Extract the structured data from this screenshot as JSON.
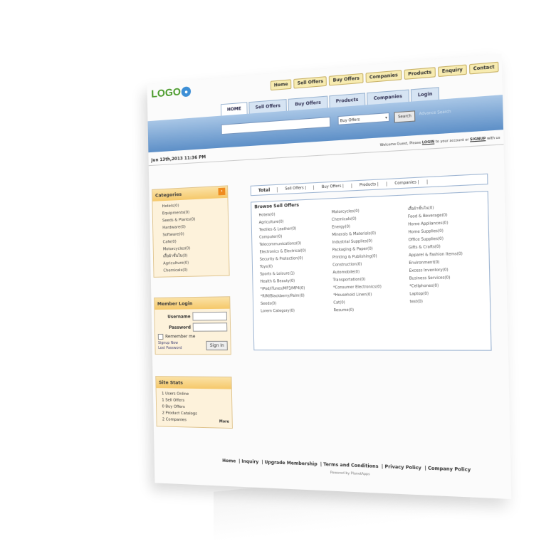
{
  "logo": "LOGO",
  "topnav": [
    "Home",
    "Sell Offers",
    "Buy Offers",
    "Companies",
    "Products",
    "Enquiry",
    "Contact"
  ],
  "tabs": [
    "HOME",
    "Sell Offers",
    "Buy Offers",
    "Products",
    "Companies",
    "Login"
  ],
  "search": {
    "select_value": "Buy Offers",
    "button": "Search",
    "advanced": "Advance Search"
  },
  "date": "Jun 13th,2013 11:36 PM",
  "welcome": {
    "prefix": "Welcome Guest, Please",
    "login": "LOGIN",
    "middle": "to your account or",
    "signup": "SIGNUP",
    "suffix": "with us"
  },
  "categories": {
    "title": "Categories",
    "items": [
      "Hotels(0)",
      "Equipments(0)",
      "Seeds & Plants(0)",
      "Hardware(0)",
      "Software(0)",
      "Cafe(0)",
      "Motorcycles(0)",
      "เสื้อผ้าชั้นใน(0)",
      "Agriculture(0)",
      "Chemicals(0)"
    ]
  },
  "login": {
    "title": "Member Login",
    "username": "Username",
    "password": "Password",
    "remember": "Remember me",
    "signup": "Signup Now",
    "lost": "Lost Password",
    "button": "Sign In"
  },
  "stats": {
    "title": "Site Stats",
    "items": [
      "1 Users Online",
      "1 Sell Offers",
      "0 Buy Offers",
      "2 Product Catalogs",
      "2 Companies"
    ],
    "more": "More"
  },
  "totals": {
    "total": "Total",
    "sell": "Sell Offers |",
    "buy": "Buy Offers |",
    "products": "Products |",
    "companies": "Companies |"
  },
  "browse": {
    "title": "Browse Sell Offers",
    "col1": [
      "Hotels(0)",
      "Agriculture(0)",
      "Textiles & Leather(0)",
      "Computer(0)",
      "Telecommunications(0)",
      "Electronics & Electrical(0)",
      "Security & Protection(0)",
      "Toys(0)",
      "Sports & Leisure(1)",
      "Health & Beauty(0)",
      "*iPod/iTunes/MP3/MP4(0)",
      "*RIM/Blackberry/Palm(0)",
      "Seeds(0)",
      "Lorem Category(0)"
    ],
    "col2": [
      "Motorcycles(0)",
      "Chemicals(0)",
      "Energy(0)",
      "Minerals & Materials(0)",
      "Industrial Supplies(0)",
      "Packaging & Paper(0)",
      "Printing & Publishing(0)",
      "Construction(0)",
      "Automobile(0)",
      "Transportation(0)",
      "*Consumer Electronics(0)",
      "*Household Linen(0)",
      "Cat(0)",
      "Resume(0)"
    ],
    "col3": [
      "เสื้อผ้าชั้นใน(0)",
      "Food & Beverage(0)",
      "Home Appliances(0)",
      "Home Supplies(0)",
      "Office Supplies(0)",
      "Gifts & Crafts(0)",
      "Apparel & Fashion Items(0)",
      "Environment(0)",
      "Excess Inventory(0)",
      "Business Services(0)",
      "*Cellphones(0)",
      "Laptop(0)",
      "test(0)"
    ]
  },
  "footer": {
    "links": [
      "Home",
      "Inquiry",
      "Upgrade Membership",
      "Terms and Conditions",
      "Privacy Policy",
      "Company Policy"
    ],
    "powered": "Powered by PlanetApps"
  }
}
